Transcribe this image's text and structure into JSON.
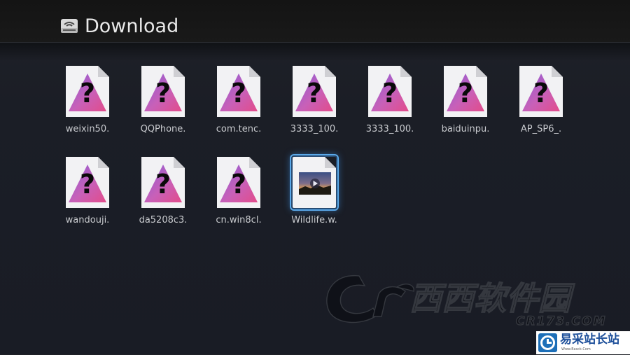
{
  "header": {
    "title": "Download",
    "icon": "storage-drive-icon"
  },
  "files": [
    {
      "label": "weixin50.",
      "type": "unknown",
      "selected": false
    },
    {
      "label": "QQPhone.",
      "type": "unknown",
      "selected": false
    },
    {
      "label": "com.tenc.",
      "type": "unknown",
      "selected": false
    },
    {
      "label": "3333_100.",
      "type": "unknown",
      "selected": false
    },
    {
      "label": "3333_100.",
      "type": "unknown",
      "selected": false
    },
    {
      "label": "baiduinpu.",
      "type": "unknown",
      "selected": false
    },
    {
      "label": "AP_SP6_.",
      "type": "unknown",
      "selected": false
    },
    {
      "label": "wandouji.",
      "type": "unknown",
      "selected": false
    },
    {
      "label": "da5208c3.",
      "type": "unknown",
      "selected": false
    },
    {
      "label": "cn.win8cl.",
      "type": "unknown",
      "selected": false
    },
    {
      "label": "Wildlife.w.",
      "type": "video",
      "selected": true
    }
  ],
  "watermark": {
    "chinese": "西西软件园",
    "latin": "CR173.COM"
  },
  "badge": {
    "text": "易采站长站",
    "sub": "Www.Easck.Com"
  },
  "colors": {
    "background": "#1b1e26",
    "header": "#161616",
    "selection": "#5aa8e8",
    "label": "#c9cbcf"
  }
}
